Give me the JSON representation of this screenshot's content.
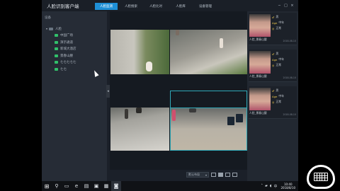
{
  "app": {
    "title": "人脸识别客户端",
    "tabs": [
      {
        "label": "人脸监测",
        "active": true
      },
      {
        "label": "人脸搜索",
        "active": false
      },
      {
        "label": "人脸比对",
        "active": false
      },
      {
        "label": "人脸库",
        "active": false
      },
      {
        "label": "设备管理",
        "active": false
      }
    ],
    "window_controls": [
      "−",
      "□",
      "×"
    ]
  },
  "sidebar": {
    "header": "设备",
    "root": {
      "label": "人脸",
      "expanded": true
    },
    "items": [
      {
        "label": "中国广场"
      },
      {
        "label": "演示通道"
      },
      {
        "label": "新城大酒店"
      },
      {
        "label": "景春山腰"
      },
      {
        "label": "七七七七七"
      },
      {
        "label": "七七"
      }
    ],
    "collapse_handle": "◂"
  },
  "view_bar": {
    "layout_select": "默认布局",
    "layout_buttons": [
      "1x1",
      "2x2",
      "3x3",
      "4x4"
    ],
    "active_layout": 1
  },
  "recognition": {
    "cards": [
      {
        "caption": "人脸_景春山腰",
        "time": "2018-08-10",
        "gender_icon": "male-icon",
        "gender": "男",
        "age_label": "Age",
        "age": "中年",
        "glasses": "正常"
      },
      {
        "caption": "人脸_景春山腰",
        "time": "2018-08-10",
        "gender_icon": "male-icon",
        "gender": "男",
        "age_label": "Age",
        "age": "中年",
        "glasses": "正常"
      },
      {
        "caption": "人脸_景春山腰",
        "time": "2018-08-10",
        "gender_icon": "male-icon",
        "gender": "男",
        "age_label": "Age",
        "age": "中年",
        "glasses": "正常"
      }
    ]
  },
  "taskbar": {
    "apps": [
      "windows-start-icon",
      "search-icon",
      "task-view-icon",
      "edge-icon",
      "explorer-icon",
      "store-icon",
      "app-icon-1",
      "app-icon-2"
    ],
    "clock_time": "10:40",
    "clock_date": "2018/8/10"
  },
  "colors": {
    "accent": "#1e8fd6",
    "camera_online": "#31c06a",
    "attr_icon": "#e8c44a",
    "selected_cell_border": "#2fa9b8"
  }
}
